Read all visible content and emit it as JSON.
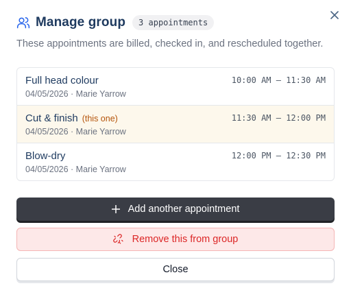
{
  "dialog": {
    "title": "Manage group",
    "badge": "3 appointments",
    "subtitle": "These appointments are billed, checked in, and rescheduled together."
  },
  "appointments": [
    {
      "service": "Full head colour",
      "tag": "",
      "date_staff": "04/05/2026 · Marie Yarrow",
      "time": "10:00 AM – 11:30 AM",
      "current": false
    },
    {
      "service": "Cut & finish",
      "tag": "(this one)",
      "date_staff": "04/05/2026 · Marie Yarrow",
      "time": "11:30 AM – 12:00 PM",
      "current": true
    },
    {
      "service": "Blow-dry",
      "tag": "",
      "date_staff": "04/05/2026 · Marie Yarrow",
      "time": "12:00 PM – 12:30 PM",
      "current": false
    }
  ],
  "actions": {
    "add_label": "Add another appointment",
    "remove_label": "Remove this from group",
    "close_label": "Close"
  },
  "icons": {
    "header": "users-icon",
    "close": "close-icon",
    "add": "plus-icon",
    "remove": "unlink-icon"
  },
  "colors": {
    "title": "#1e3a5f",
    "primary_button": "#3a3d45",
    "danger_text": "#dc2626",
    "danger_bg": "#fde8e8",
    "current_row_bg": "#fdf8ec",
    "tag": "#b45309"
  }
}
